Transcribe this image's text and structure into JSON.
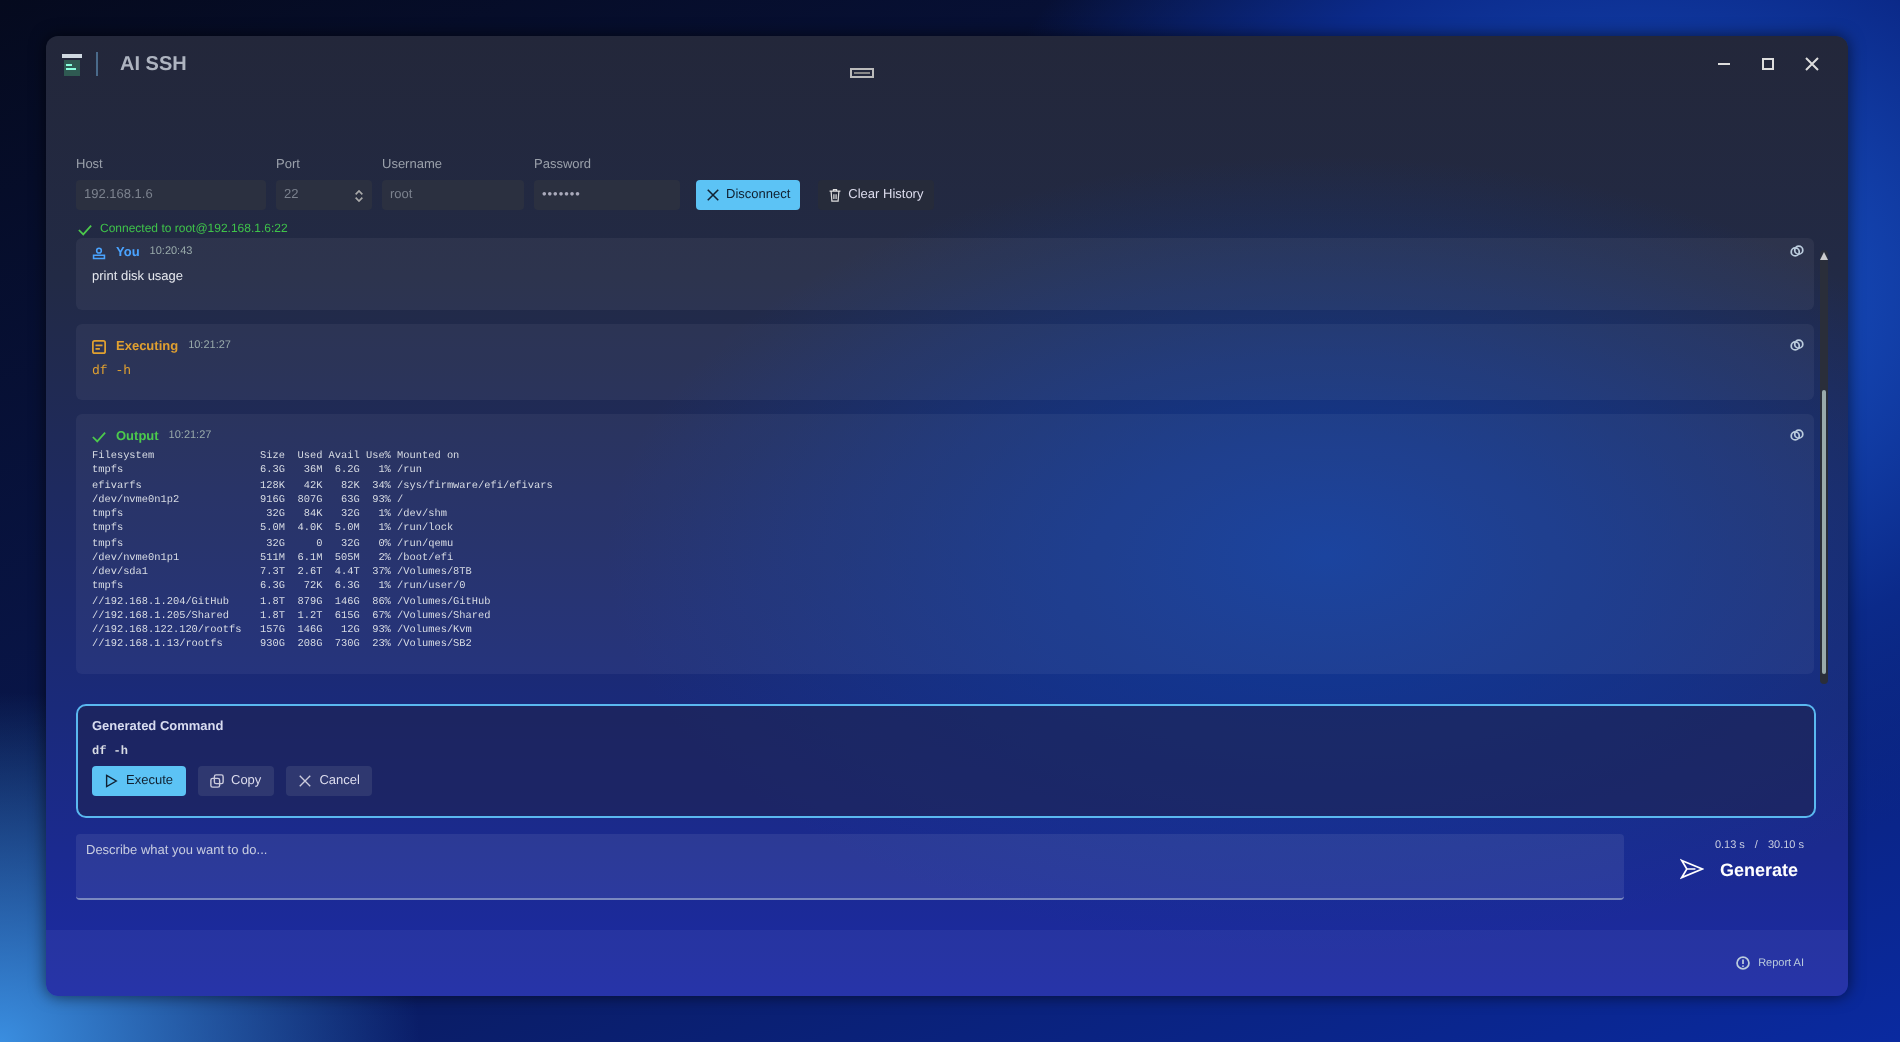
{
  "window": {
    "title": "AI SSH"
  },
  "connection": {
    "fields": [
      {
        "label": "Host",
        "value": "192.168.1.6",
        "kind": "text"
      },
      {
        "label": "Port",
        "value": "22",
        "kind": "number"
      },
      {
        "label": "Username",
        "value": "root",
        "kind": "text"
      },
      {
        "label": "Password",
        "value": "•••••••",
        "kind": "password"
      }
    ],
    "buttons": [
      {
        "label": "Disconnect",
        "kind": "primary"
      },
      {
        "label": "Clear History",
        "kind": "secondary"
      }
    ],
    "status": "Connected to root@192.168.1.6:22"
  },
  "messages": [
    {
      "kind": "user",
      "label": "You",
      "time": "10:20:43",
      "text": "print disk usage"
    },
    {
      "kind": "executing",
      "label": "Executing",
      "time": "10:21:27",
      "text": "df -h"
    },
    {
      "kind": "output",
      "label": "Output",
      "time": "10:21:27",
      "lines": [
        "Filesystem                 Size  Used Avail Use% Mounted on",
        "tmpfs                      6.3G   36M  6.2G   1% /run",
        "efivarfs                   128K   42K   82K  34% /sys/firmware/efi/efivars",
        "/dev/nvme0n1p2             916G  807G   63G  93% /",
        "tmpfs                       32G   84K   32G   1% /dev/shm",
        "tmpfs                      5.0M  4.0K  5.0M   1% /run/lock",
        "tmpfs                       32G     0   32G   0% /run/qemu",
        "/dev/nvme0n1p1             511M  6.1M  505M   2% /boot/efi",
        "/dev/sda1                  7.3T  2.6T  4.4T  37% /Volumes/8TB",
        "tmpfs                      6.3G   72K  6.3G   1% /run/user/0",
        "//192.168.1.204/GitHub     1.8T  879G  146G  86% /Volumes/GitHub",
        "//192.168.1.205/Shared     1.8T  1.2T  615G  67% /Volumes/Shared",
        "//192.168.122.120/rootfs   157G  146G   12G  93% /Volumes/Kvm",
        "//192.168.1.13/rootfs      930G  208G  730G  23% /Volumes/SB2"
      ]
    }
  ],
  "generated": {
    "title": "Generated Command",
    "command": "df -h",
    "buttons": [
      {
        "label": "Execute",
        "kind": "primary"
      },
      {
        "label": "Copy",
        "kind": "copy"
      },
      {
        "label": "Cancel",
        "kind": "cancel"
      }
    ]
  },
  "prompt": {
    "placeholder": "Describe what you want to do..."
  },
  "timing": {
    "elapsed": "0.13 s",
    "separator": "/",
    "total": "30.10 s"
  },
  "generate_button": "Generate",
  "footer": {
    "link": "Report AI"
  }
}
